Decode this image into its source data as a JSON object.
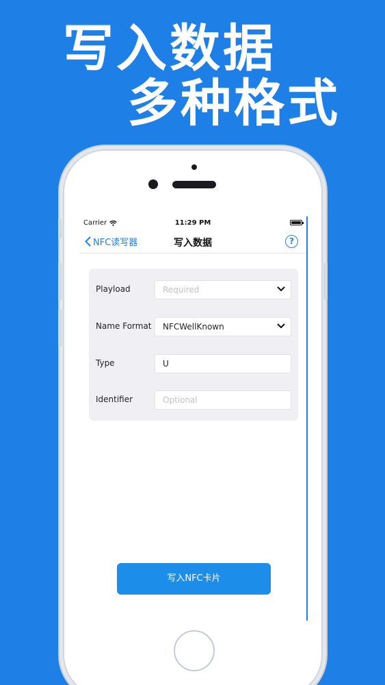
{
  "promo": {
    "line1": "写入数据",
    "line2": "多种格式"
  },
  "status_bar": {
    "carrier": "Carrier",
    "time": "11:29 PM"
  },
  "nav": {
    "back_label": "NFC读写器",
    "title": "写入数据",
    "help_label": "?"
  },
  "form": {
    "payload": {
      "label": "Playload",
      "value": "",
      "placeholder": "Required"
    },
    "name_format": {
      "label": "Name Format",
      "value": "NFCWellKnown"
    },
    "type": {
      "label": "Type",
      "value": "U"
    },
    "identifier": {
      "label": "Identifier",
      "value": "",
      "placeholder": "Optional"
    }
  },
  "actions": {
    "write_button": "写入NFC卡片"
  },
  "colors": {
    "background": "#1E80E6",
    "accent": "#1E80E6",
    "button": "#1C8EEA",
    "card": "#EFEFF4"
  },
  "icons": [
    "wifi-icon",
    "battery-icon",
    "back-chevron-icon",
    "help-icon",
    "chevron-down-icon"
  ]
}
